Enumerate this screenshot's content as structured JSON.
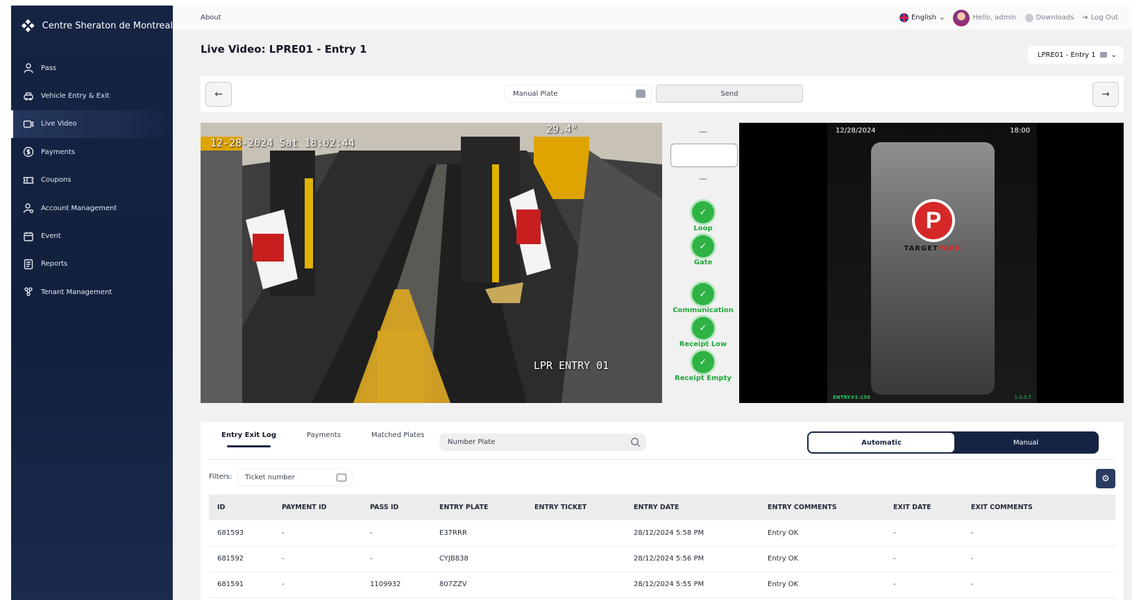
{
  "brand": {
    "name": "Centre Sheraton de Montreal"
  },
  "sidebar": {
    "items": [
      {
        "label": "Pass",
        "icon": "user-icon"
      },
      {
        "label": "Vehicle Entry & Exit",
        "icon": "car-icon"
      },
      {
        "label": "Live Video",
        "icon": "video-icon",
        "active": true
      },
      {
        "label": "Payments",
        "icon": "dollar-icon"
      },
      {
        "label": "Coupons",
        "icon": "ticket-icon"
      },
      {
        "label": "Account Management",
        "icon": "user-gear-icon"
      },
      {
        "label": "Event",
        "icon": "calendar-icon"
      },
      {
        "label": "Reports",
        "icon": "report-icon"
      },
      {
        "label": "Tenant Management",
        "icon": "group-icon"
      }
    ]
  },
  "topbar": {
    "about": "About",
    "language": "English",
    "greeting": "Hello, admin",
    "downloads": "Downloads",
    "logout": "Log Out"
  },
  "page": {
    "title": "Live Video: LPRE01 - Entry 1",
    "entry_select": "LPRE01 - Entry 1"
  },
  "controls": {
    "manual_plate_placeholder": "Manual Plate",
    "send_label": "Send"
  },
  "camera": {
    "timestamp": "12-28-2024 Sat 18:02:44",
    "temperature": "29.4°",
    "label": "LPR ENTRY 01"
  },
  "status": {
    "top_dash": "---",
    "mid_dash": "---",
    "items": [
      {
        "label": "Loop"
      },
      {
        "label": "Gate"
      },
      {
        "label": "Communication"
      },
      {
        "label": "Receipt Low"
      },
      {
        "label": "Receipt Empty"
      }
    ]
  },
  "screen": {
    "date": "12/28/2024",
    "time": "18:00",
    "brand_a": "TARGET",
    "brand_b": "PARK",
    "footer_left": "ENTRY#1-150",
    "footer_right": "1.0.0.7"
  },
  "lower": {
    "tabs": [
      "Entry Exit Log",
      "Payments",
      "Matched Plates"
    ],
    "search_placeholder": "Number Plate",
    "toggle": {
      "automatic": "Automatic",
      "manual": "Manual"
    },
    "filters_label": "Filters:",
    "ticket_placeholder": "Ticket number"
  },
  "table": {
    "headers": [
      "ID",
      "PAYMENT ID",
      "PASS ID",
      "ENTRY PLATE",
      "ENTRY TICKET",
      "ENTRY DATE",
      "ENTRY COMMENTS",
      "EXIT DATE",
      "EXIT COMMENTS"
    ],
    "rows": [
      [
        "681593",
        "-",
        "-",
        "E37RRR",
        "",
        "28/12/2024 5:58 PM",
        "Entry OK",
        "-",
        "-"
      ],
      [
        "681592",
        "-",
        "-",
        "CYJB838",
        "",
        "28/12/2024 5:56 PM",
        "Entry OK",
        "-",
        "-"
      ],
      [
        "681591",
        "-",
        "1109932",
        "807ZZV",
        "",
        "28/12/2024 5:55 PM",
        "Entry OK",
        "-",
        "-"
      ]
    ]
  }
}
